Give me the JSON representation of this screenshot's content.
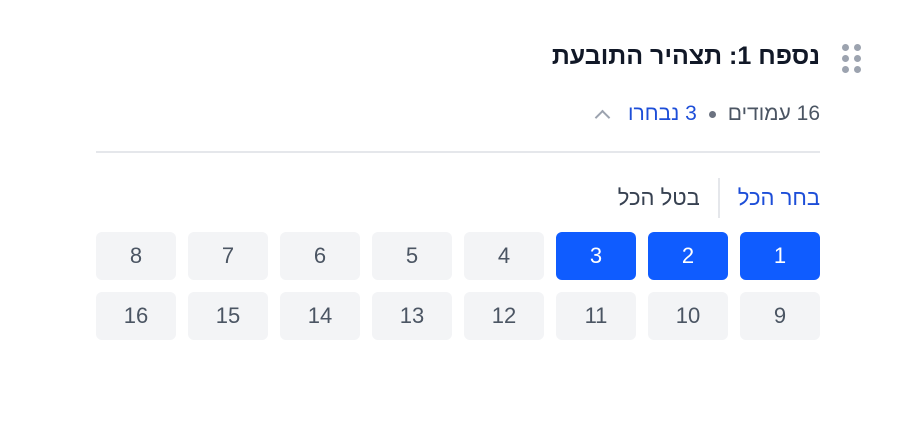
{
  "header": {
    "title": "נספח 1: תצהיר התובעת",
    "pages_text": "16 עמודים",
    "selected_text": "3 נבחרו"
  },
  "actions": {
    "select_all": "בחר הכל",
    "deselect_all": "בטל הכל"
  },
  "pages": [
    {
      "label": "1",
      "selected": true
    },
    {
      "label": "2",
      "selected": true
    },
    {
      "label": "3",
      "selected": true
    },
    {
      "label": "4",
      "selected": false
    },
    {
      "label": "5",
      "selected": false
    },
    {
      "label": "6",
      "selected": false
    },
    {
      "label": "7",
      "selected": false
    },
    {
      "label": "8",
      "selected": false
    },
    {
      "label": "9",
      "selected": false
    },
    {
      "label": "10",
      "selected": false
    },
    {
      "label": "11",
      "selected": false
    },
    {
      "label": "12",
      "selected": false
    },
    {
      "label": "13",
      "selected": false
    },
    {
      "label": "14",
      "selected": false
    },
    {
      "label": "15",
      "selected": false
    },
    {
      "label": "16",
      "selected": false
    }
  ],
  "colors": {
    "accent": "#0f5cff",
    "link": "#1d4ed8",
    "tile_bg": "#f3f4f6"
  },
  "icons": {
    "drag_handle": "drag-handle-icon",
    "collapse": "chevron-up-icon"
  }
}
